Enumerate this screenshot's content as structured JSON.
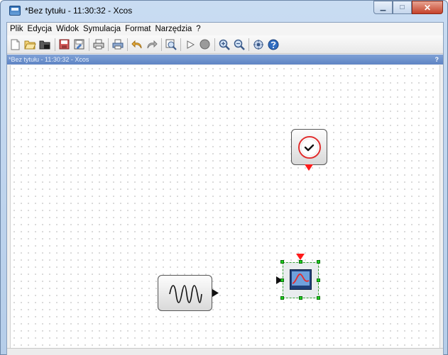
{
  "window": {
    "title": "*Bez tytułu - 11:30:32 - Xcos",
    "minimize_glyph": "▁",
    "maximize_glyph": "□",
    "close_glyph": "✕"
  },
  "menu": [
    {
      "label": "Plik"
    },
    {
      "label": "Edycja"
    },
    {
      "label": "Widok"
    },
    {
      "label": "Symulacja"
    },
    {
      "label": "Format"
    },
    {
      "label": "Narzędzia"
    },
    {
      "label": "?"
    }
  ],
  "toolbar": {
    "buttons": [
      {
        "icon": "new-diagram-icon"
      },
      {
        "icon": "open-icon"
      },
      {
        "icon": "open-in-scilab-icon"
      },
      {
        "icon": "save-icon"
      },
      {
        "icon": "save-as-icon"
      },
      {
        "icon": "print-icon"
      },
      {
        "icon": "export-icon"
      },
      {
        "icon": "undo-icon"
      },
      {
        "icon": "redo-icon"
      },
      {
        "icon": "fit-diagram-icon"
      },
      {
        "icon": "start-icon"
      },
      {
        "icon": "stop-icon"
      },
      {
        "icon": "zoom-in-icon"
      },
      {
        "icon": "zoom-out-icon"
      },
      {
        "icon": "palette-browser-icon"
      },
      {
        "icon": "help-icon"
      }
    ]
  },
  "docbar": {
    "title": "*Bez tytułu - 11:30:32 - Xcos",
    "help": "?"
  },
  "blocks": [
    {
      "name": "clock-block",
      "icon": "clock-icon"
    },
    {
      "name": "sine-generator-block",
      "icon": "sine-wave-icon"
    },
    {
      "name": "scope-block",
      "icon": "scope-icon",
      "selected": true
    }
  ],
  "colors": {
    "titlebar": "#b5cde9",
    "docbar": "#5e84c4",
    "selection_handle": "#1ed21e",
    "event_port": "#ff1a1a",
    "close_button": "#c5422b"
  }
}
